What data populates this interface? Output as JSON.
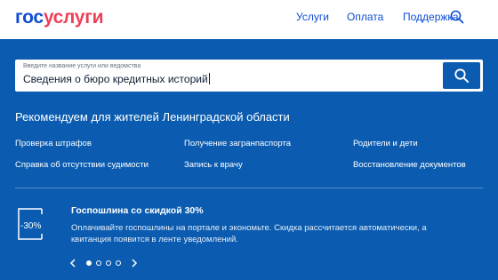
{
  "header": {
    "logo_part1": "гос",
    "logo_part2": "услуги",
    "nav": [
      "Услуги",
      "Оплата",
      "Поддержка"
    ],
    "search_icon": "search-icon"
  },
  "search": {
    "placeholder": "Введите название услуги или ведомства",
    "value": "Сведения о бюро кредитных историй",
    "button_icon": "search-icon"
  },
  "recommend": {
    "title": "Рекомендуем для жителей Ленинградской области",
    "links": [
      [
        "Проверка штрафов",
        "Получение загранпаспорта",
        "Родители и дети"
      ],
      [
        "Справка об отсутствии судимости",
        "Запись к врачу",
        "Восстановление документов"
      ]
    ]
  },
  "promo": {
    "badge": "-30%",
    "title": "Госпошлина со скидкой 30%",
    "text": "Оплачивайте госпошлины на портале и экономьте. Скидка рассчитается автоматически, а квитанция появится в ленте уведомлений.",
    "carousel_total": 4,
    "carousel_active": 0
  },
  "colors": {
    "background": "#0b5cb0",
    "header_bg": "#ffffff",
    "logo_blue": "#0d4cd3",
    "logo_red": "#ee3f58",
    "nav_text": "#0d4cd3"
  }
}
